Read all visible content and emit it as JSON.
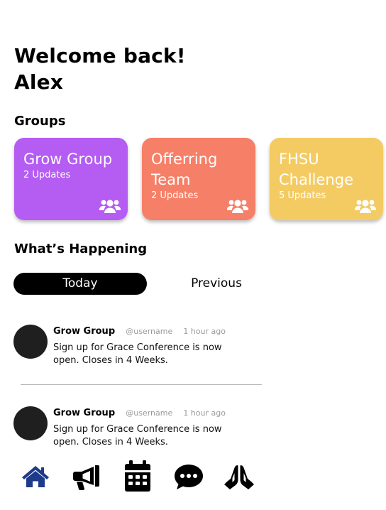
{
  "header": {
    "welcome_line1": "Welcome back!",
    "welcome_line2": "Alex"
  },
  "groups": {
    "title": "Groups",
    "items": [
      {
        "name": "Grow Group",
        "updates": "2 Updates",
        "color": "#b55cf2",
        "icon": "users-icon"
      },
      {
        "name": "Offerring Team",
        "updates": "2 Updates",
        "color": "#f67f68",
        "icon": "users-icon"
      },
      {
        "name": "FHSU Challenge",
        "updates": "5 Updates",
        "color": "#f4cb63",
        "icon": "users-icon"
      }
    ]
  },
  "happening": {
    "title": "What’s Happening",
    "tabs": [
      {
        "label": "Today",
        "active": true
      },
      {
        "label": "Previous",
        "active": false
      }
    ],
    "posts": [
      {
        "group": "Grow Group",
        "username": "@username",
        "time": "1 hour ago",
        "body": "Sign up for Grace Conference is now open. Closes in 4 Weeks."
      },
      {
        "group": "Grow Group",
        "username": "@username",
        "time": "1 hour ago",
        "body": "Sign up for Grace Conference is now open. Closes in 4 Weeks."
      }
    ]
  },
  "nav": {
    "items": [
      {
        "icon": "home-icon",
        "active": true,
        "color": "#1e3a8a"
      },
      {
        "icon": "megaphone-icon",
        "active": false,
        "color": "#000000"
      },
      {
        "icon": "calendar-icon",
        "active": false,
        "color": "#000000"
      },
      {
        "icon": "chat-icon",
        "active": false,
        "color": "#000000"
      },
      {
        "icon": "praying-hands-icon",
        "active": false,
        "color": "#000000"
      }
    ]
  }
}
